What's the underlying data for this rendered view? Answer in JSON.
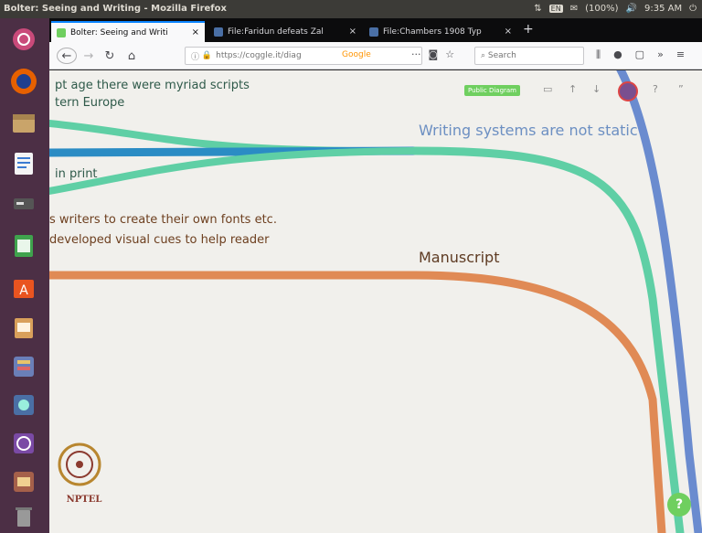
{
  "top_panel": {
    "window_title": "Bolter: Seeing and Writing - Mozilla Firefox",
    "keyboard": "EN",
    "battery": "(100%)",
    "clock": "9:35 AM"
  },
  "tabs": [
    {
      "label": "Bolter: Seeing and Writi",
      "active": true
    },
    {
      "label": "File:Faridun defeats Zal",
      "active": false
    },
    {
      "label": "File:Chambers 1908 Typ",
      "active": false
    }
  ],
  "tab_close_glyph": "×",
  "new_tab_glyph": "+",
  "address_bar": {
    "url": "https://coggle.it/diag",
    "search_engine_badge": "Google"
  },
  "search_bar": {
    "placeholder": "Search"
  },
  "mindmap": {
    "nodes": {
      "script_age_line1": "pt age there were myriad scripts",
      "script_age_line2": "tern Europe",
      "in_print": "in print",
      "writers_fonts": "s writers to create their own fonts etc.",
      "visual_cues": "developed visual cues to help reader",
      "writing_systems": "Writing systems are not static",
      "manuscript": "Manuscript"
    },
    "public_diagram_badge": "Public Diagram",
    "help_button": "?"
  },
  "watermark": {
    "label": "NPTEL"
  },
  "colors": {
    "green_branch": "#5fcfa5",
    "blue_branch": "#2b8cc4",
    "orange_branch": "#e08a55",
    "right_blue_branch": "#5b7fcc",
    "launcher_bg": "#4c2f45",
    "help_green": "#6fcf5f"
  }
}
